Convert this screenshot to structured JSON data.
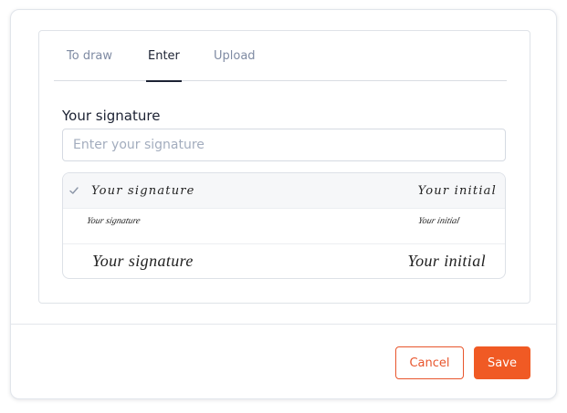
{
  "tabs": [
    {
      "label": "To draw",
      "active": false
    },
    {
      "label": "Enter",
      "active": true
    },
    {
      "label": "Upload",
      "active": false
    }
  ],
  "signature_field": {
    "label": "Your signature",
    "placeholder": "Enter your signature",
    "value": ""
  },
  "style_options": [
    {
      "signature": "Your signature",
      "initial": "Your initial",
      "selected": true,
      "icon": "check-icon"
    },
    {
      "signature": "Your signature",
      "initial": "Your initial",
      "selected": false
    },
    {
      "signature": "Your signature",
      "initial": "Your initial",
      "selected": false
    }
  ],
  "footer": {
    "cancel_label": "Cancel",
    "save_label": "Save"
  },
  "colors": {
    "accent": "#f05a24",
    "active_tab": "#1c2233",
    "inactive_tab": "#7f8ba3",
    "selected_row": "#f6f7f9"
  }
}
